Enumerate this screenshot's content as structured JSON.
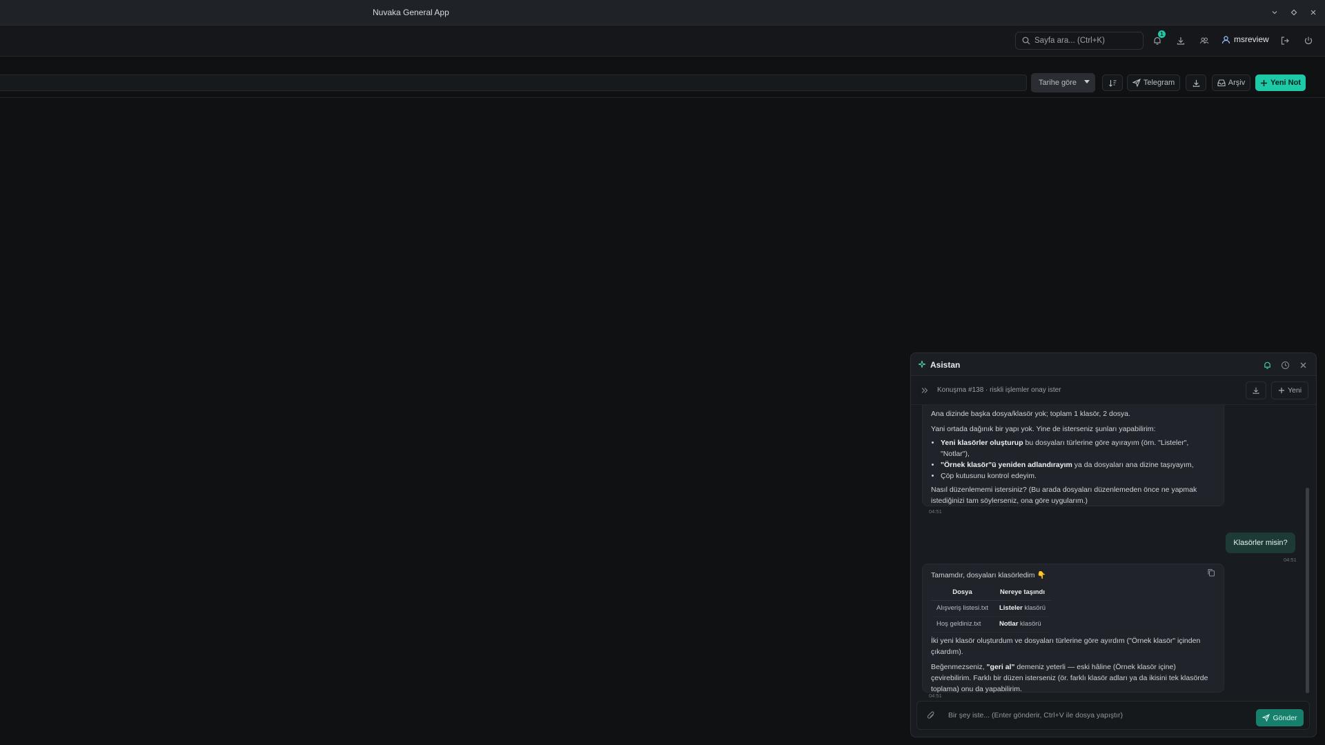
{
  "window": {
    "title": "Nuvaka General App"
  },
  "appbar": {
    "search_placeholder": "Sayfa ara... (Ctrl+K)",
    "notification_count": "1",
    "username": "msreview"
  },
  "toolbar": {
    "sort_select": "Tarihe göre",
    "telegram_label": "Telegram",
    "archive_label": "Arşiv",
    "new_note_label": "Yeni Not"
  },
  "assistant": {
    "title": "Asistan",
    "conversation_info": "Konuşma #138 · riskli işlemler onay ister",
    "new_label": "Yeni",
    "messages": {
      "m1": {
        "line1": "Ana dizinde başka dosya/klasör yok; toplam 1 klasör, 2 dosya.",
        "line2": "Yani ortada dağınık bir yapı yok. Yine de isterseniz şunları yapabilirim:",
        "b1_bold": "Yeni klasörler oluşturup",
        "b1_rest": " bu dosyaları türlerine göre ayırayım (örn. \"Listeler\", \"Notlar\"),",
        "b2_bold": "\"Örnek klasör\"ü yeniden adlandırayım",
        "b2_rest": " ya da dosyaları ana dizine taşıyayım,",
        "b3": "Çöp kutusunu kontrol edeyim.",
        "line3": "Nasıl düzenlememi istersiniz? (Bu arada dosyaları düzenlemeden önce ne yapmak istediğinizi tam söylerseniz, ona göre uygularım.)",
        "time": "04:51"
      },
      "m2": {
        "text": "Klasörler misin?",
        "time": "04:51"
      },
      "m3": {
        "line1": "Tamamdır, dosyaları klasörledim 👇",
        "table_headers": [
          "Dosya",
          "Nereye taşındı"
        ],
        "rows": [
          {
            "file": "Alışveriş listesi.txt",
            "dest_bold": "Listeler",
            "dest_rest": " klasörü"
          },
          {
            "file": "Hoş geldiniz.txt",
            "dest_bold": "Notlar",
            "dest_rest": " klasörü"
          }
        ],
        "line2": "İki yeni klasör oluşturdum ve dosyaları türlerine göre ayırdım (\"Örnek klasör\" içinden çıkardım).",
        "line3_pre": "Beğenmezseniz, ",
        "line3_bold": "\"geri al\"",
        "line3_post": " demeniz yeterli — eski hâline (Örnek klasör içine) çevirebilirim. Farklı bir düzen isterseniz (ör. farklı klasör adları ya da ikisini tek klasörde toplama) onu da yapabilirim.",
        "time": "04:51"
      }
    },
    "composer_placeholder": "Bir şey iste... (Enter gönderir, Ctrl+V ile dosya yapıştır)",
    "send_label": "Gönder"
  },
  "colors": {
    "accent": "#1ec9a8",
    "background": "#0f1113",
    "panel": "#181b1f"
  }
}
